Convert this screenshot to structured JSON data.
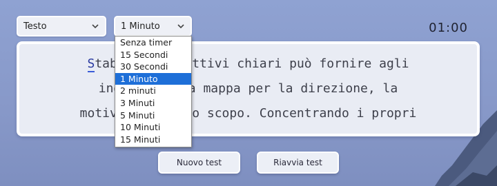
{
  "controls": {
    "mode_select": {
      "value": "Testo",
      "icon": "chevron-down-icon"
    },
    "time_select": {
      "value": "1 Minuto",
      "icon": "chevron-down-icon",
      "options": [
        "Senza timer",
        "15 Secondi",
        "30 Secondi",
        "1 Minuto",
        "2 minuti",
        "3 Minuti",
        "5 Minuti",
        "10 Minuti",
        "15 Minuti"
      ],
      "selected_index": 3
    }
  },
  "timer": {
    "display": "01:00"
  },
  "text_area": {
    "current_char": "S",
    "lines": [
      "tabilire obiettivi chiari può fornire agli",
      "individui una mappa per la direzione, la",
      "motivazione e lo scopo. Concentrando i propri"
    ]
  },
  "buttons": {
    "new_test": "Nuovo test",
    "restart_test": "Riavvia test"
  },
  "colors": {
    "accent": "#1e6fd8",
    "background": "#8fa2d2",
    "cursor": "#3a5bd8"
  }
}
